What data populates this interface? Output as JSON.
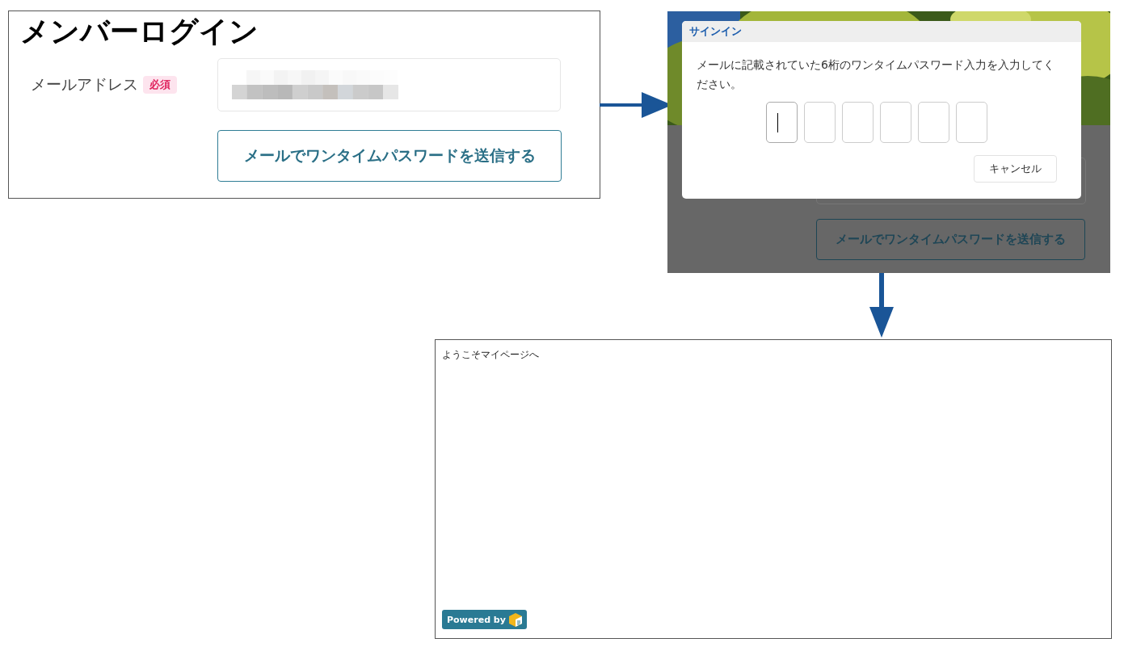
{
  "login_panel": {
    "title": "メンバーログイン",
    "field": {
      "label": "メールアドレス",
      "badge": "必須"
    },
    "button": "メールでワンタイムパスワードを送信する"
  },
  "signin_panel": {
    "background_button": "メールでワンタイムパスワードを送信する",
    "dialog": {
      "title": "サインイン",
      "message": "メールに記載されていた6桁のワンタイムパスワード入力を入力してください。",
      "code_boxes": [
        {
          "focused": true
        },
        {
          "focused": false
        },
        {
          "focused": false
        },
        {
          "focused": false
        },
        {
          "focused": false
        },
        {
          "focused": false
        }
      ],
      "cancel_button": "キャンセル"
    }
  },
  "mypage_panel": {
    "greeting": "ようこそマイページへ",
    "badge": "Powered by"
  }
}
